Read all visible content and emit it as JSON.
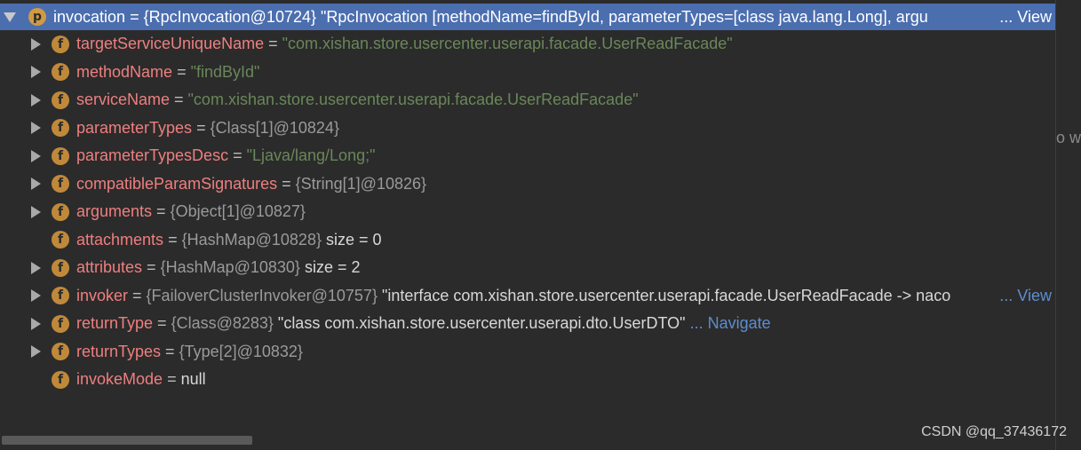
{
  "root": {
    "badge": "p",
    "name": "invocation",
    "eq": " = ",
    "ref": "{RpcInvocation@10724}",
    "value": " \"RpcInvocation [methodName=findById, parameterTypes=[class java.lang.Long], argu",
    "ellipsis": "...",
    "view": "View"
  },
  "fields": [
    {
      "badge": "f",
      "name": "targetServiceUniqueName",
      "eq": " = ",
      "str": "\"com.xishan.store.usercenter.userapi.facade.UserReadFacade\"",
      "expandable": true
    },
    {
      "badge": "f",
      "name": "methodName",
      "eq": " = ",
      "str": "\"findById\"",
      "expandable": true
    },
    {
      "badge": "f",
      "name": "serviceName",
      "eq": " = ",
      "str": "\"com.xishan.store.usercenter.userapi.facade.UserReadFacade\"",
      "expandable": true
    },
    {
      "badge": "f",
      "name": "parameterTypes",
      "eq": " = ",
      "ref": "{Class[1]@10824}",
      "expandable": true
    },
    {
      "badge": "f",
      "name": "parameterTypesDesc",
      "eq": " = ",
      "str": "\"Ljava/lang/Long;\"",
      "expandable": true
    },
    {
      "badge": "f",
      "name": "compatibleParamSignatures",
      "eq": " = ",
      "ref": "{String[1]@10826}",
      "expandable": true
    },
    {
      "badge": "f",
      "name": "arguments",
      "eq": " = ",
      "ref": "{Object[1]@10827}",
      "expandable": true
    },
    {
      "badge": "f",
      "name": "attachments",
      "eq": " = ",
      "ref": "{HashMap@10828}",
      "plain": "  size = 0",
      "expandable": false
    },
    {
      "badge": "f",
      "name": "attributes",
      "eq": " = ",
      "ref": "{HashMap@10830}",
      "plain": "  size = 2",
      "expandable": true
    },
    {
      "badge": "f",
      "name": "invoker",
      "eq": " = ",
      "ref": "{FailoverClusterInvoker@10757}",
      "plain": " \"interface com.xishan.store.usercenter.userapi.facade.UserReadFacade -> naco",
      "ellipsis": "...",
      "view": "View",
      "expandable": true
    },
    {
      "badge": "f",
      "name": "returnType",
      "eq": " = ",
      "ref": "{Class@8283}",
      "plain": " \"class com.xishan.store.usercenter.userapi.dto.UserDTO\"",
      "link": " ... Navigate",
      "expandable": true
    },
    {
      "badge": "f",
      "name": "returnTypes",
      "eq": " = ",
      "ref": "{Type[2]@10832}",
      "expandable": true
    },
    {
      "badge": "f",
      "name": "invokeMode",
      "eq": " = ",
      "plain": "null",
      "expandable": false
    }
  ],
  "right_fragment": "o w",
  "watermark": "CSDN @qq_37436172"
}
